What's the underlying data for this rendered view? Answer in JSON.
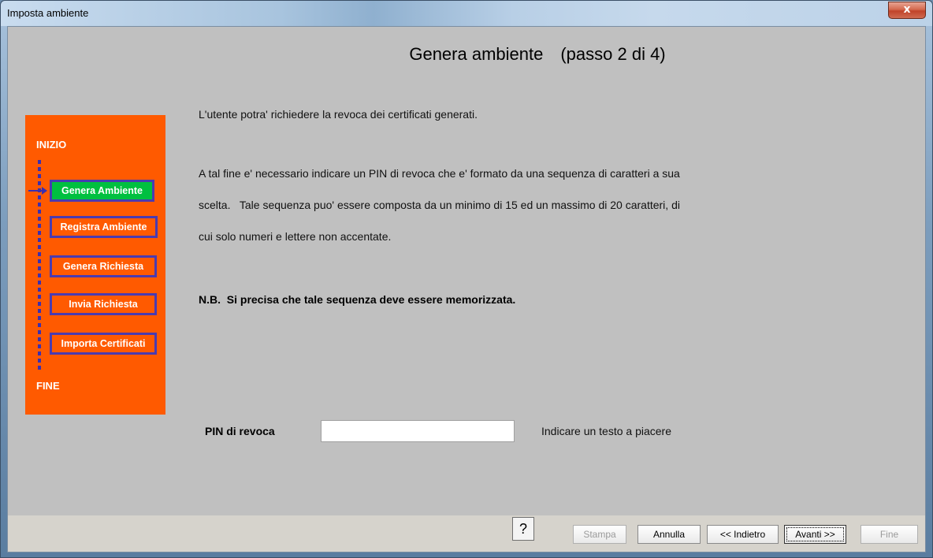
{
  "window": {
    "title": "Imposta ambiente",
    "close_glyph": "x"
  },
  "header": {
    "title": "Genera ambiente",
    "step": "(passo 2 di 4)"
  },
  "content": {
    "line1": "L'utente potra' richiedere la revoca dei certificati generati.",
    "line2": "A tal fine e' necessario indicare un PIN di revoca che e' formato da una sequenza di caratteri a sua",
    "line3": "scelta.   Tale sequenza puo' essere composta da un minimo di 15 ed un massimo di 20 caratteri, di",
    "line4": "cui solo numeri e lettere non accentate.",
    "nb": "N.B.  Si precisa che tale sequenza deve essere memorizzata."
  },
  "sidebar": {
    "start_label": "INIZIO",
    "end_label": "FINE",
    "steps": [
      {
        "label": "Genera Ambiente",
        "active": true
      },
      {
        "label": "Registra Ambiente",
        "active": false
      },
      {
        "label": "Genera Richiesta",
        "active": false
      },
      {
        "label": "Invia Richiesta",
        "active": false
      },
      {
        "label": "Importa Certificati",
        "active": false
      }
    ]
  },
  "pin": {
    "label": "PIN di revoca",
    "value": "",
    "hint": "Indicare un testo a piacere"
  },
  "footer": {
    "help_label": "?",
    "buttons": {
      "stampa": "Stampa",
      "annulla": "Annulla",
      "indietro": "<< Indietro",
      "avanti": "Avanti >>",
      "fine": "Fine"
    }
  },
  "colors": {
    "sidebar_bg": "#ff5a00",
    "active_step": "#00c040",
    "step_border": "#4a3bb0",
    "client_bg": "#c0c0c0"
  }
}
